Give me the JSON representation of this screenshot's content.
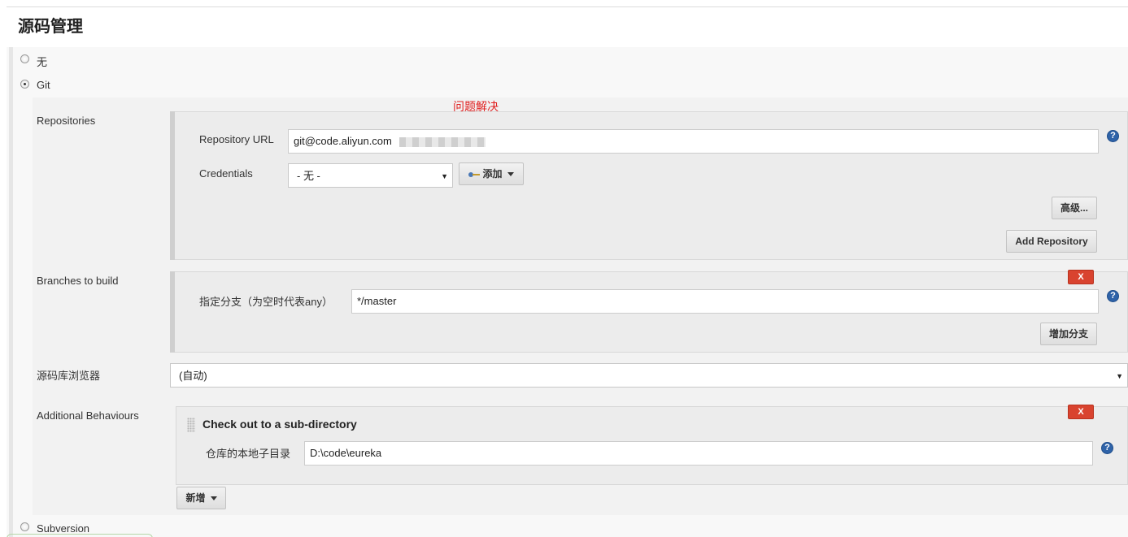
{
  "section": {
    "title": "源码管理"
  },
  "scm_options": {
    "none_label": "无",
    "git_label": "Git",
    "subversion_label": "Subversion",
    "selected": "Git"
  },
  "annotation": "问题解决",
  "repositories": {
    "label": "Repositories",
    "url_label": "Repository URL",
    "url_value": "git@code.aliyun.com",
    "credentials_label": "Credentials",
    "credentials_selected": "- 无 -",
    "add_button": "添加",
    "advanced_button": "高级...",
    "add_repository_button": "Add Repository"
  },
  "branches": {
    "label": "Branches to build",
    "branch_label": "指定分支（为空时代表any）",
    "branch_value": "*/master",
    "delete_label": "X",
    "add_branch_button": "增加分支"
  },
  "browser": {
    "label": "源码库浏览器",
    "selected": "(自动)"
  },
  "behaviours": {
    "label": "Additional Behaviours",
    "item_title": "Check out to a sub-directory",
    "subdir_label": "仓库的本地子目录",
    "subdir_value": "D:\\code\\eureka",
    "delete_label": "X",
    "add_button": "新增"
  },
  "help_glyph": "?",
  "icons": {
    "help": "question-circle-icon",
    "credentials": "key-icon",
    "dropdown": "caret-down-icon"
  },
  "colors": {
    "delete": "#d9432f",
    "help": "#2f63a8",
    "annotation": "#e02020"
  }
}
